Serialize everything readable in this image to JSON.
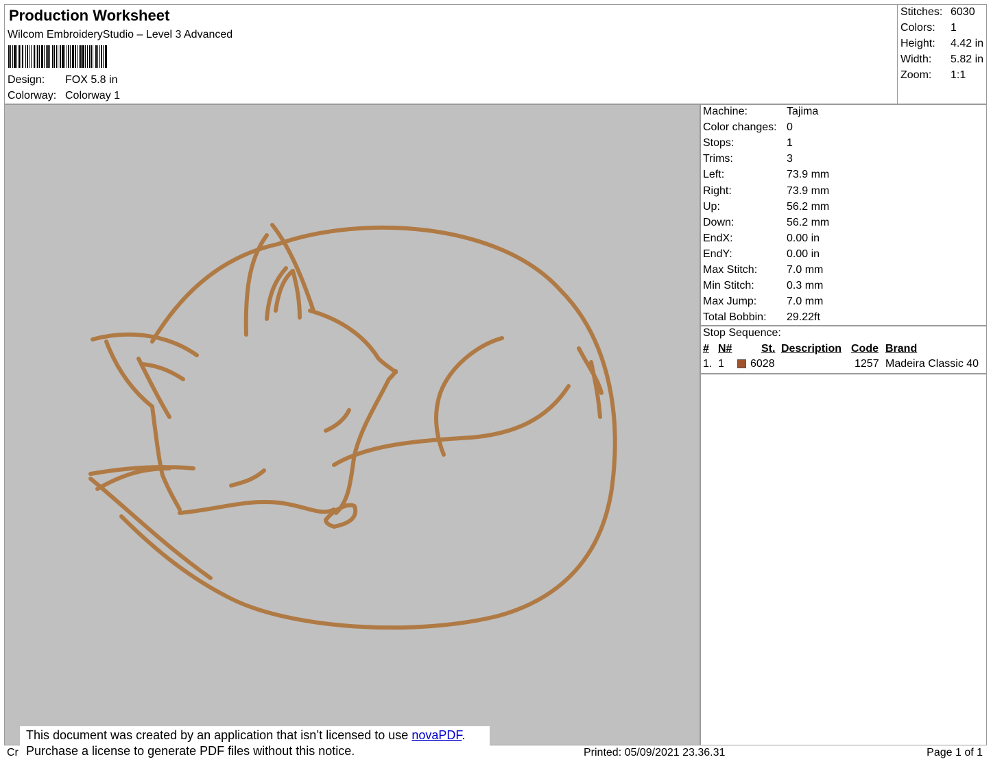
{
  "header": {
    "title": "Production Worksheet",
    "software": "Wilcom EmbroideryStudio – Level 3 Advanced",
    "design_label": "Design:",
    "design_value": "FOX 5.8 in",
    "colorway_label": "Colorway:",
    "colorway_value": "Colorway 1"
  },
  "summary": [
    {
      "label": "Stitches:",
      "value": "6030"
    },
    {
      "label": "Colors:",
      "value": "1"
    },
    {
      "label": "Height:",
      "value": "4.42 in"
    },
    {
      "label": "Width:",
      "value": "5.82 in"
    },
    {
      "label": "Zoom:",
      "value": "1:1"
    }
  ],
  "stats": [
    {
      "label": "Machine:",
      "value": "Tajima"
    },
    {
      "label": "Color changes:",
      "value": "0"
    },
    {
      "label": "Stops:",
      "value": "1"
    },
    {
      "label": "Trims:",
      "value": "3"
    },
    {
      "label": "Left:",
      "value": "73.9 mm"
    },
    {
      "label": "Right:",
      "value": "73.9 mm"
    },
    {
      "label": "Up:",
      "value": "56.2 mm"
    },
    {
      "label": "Down:",
      "value": "56.2 mm"
    },
    {
      "label": "EndX:",
      "value": "0.00 in"
    },
    {
      "label": "EndY:",
      "value": "0.00 in"
    },
    {
      "label": "Max Stitch:",
      "value": "7.0 mm"
    },
    {
      "label": "Min Stitch:",
      "value": "0.3 mm"
    },
    {
      "label": "Max Jump:",
      "value": "7.0 mm"
    },
    {
      "label": "Total Bobbin:",
      "value": "29.22ft"
    }
  ],
  "stop_sequence": {
    "title": "Stop Sequence:",
    "headers": {
      "num": "#",
      "n": "N#",
      "st": "St.",
      "description": "Description",
      "code": "Code",
      "brand": "Brand"
    },
    "rows": [
      {
        "num": "1.",
        "n": "1",
        "st": "6028",
        "description": "",
        "code": "1257",
        "brand": "Madeira Classic 40",
        "color": "#a0522d"
      }
    ]
  },
  "thread_color": "#b07a45",
  "canvas_color": "#c0c0c0",
  "footer": {
    "created_prefix": "Cr",
    "printed": "Printed: 05/09/2021 23.36.31",
    "page": "Page 1 of 1"
  },
  "notice": {
    "line1_prefix": "This document was created by an application that isn’t licensed to use ",
    "link": "novaPDF",
    "line1_suffix": ".",
    "line2": "Purchase a license to generate PDF files without this notice."
  }
}
